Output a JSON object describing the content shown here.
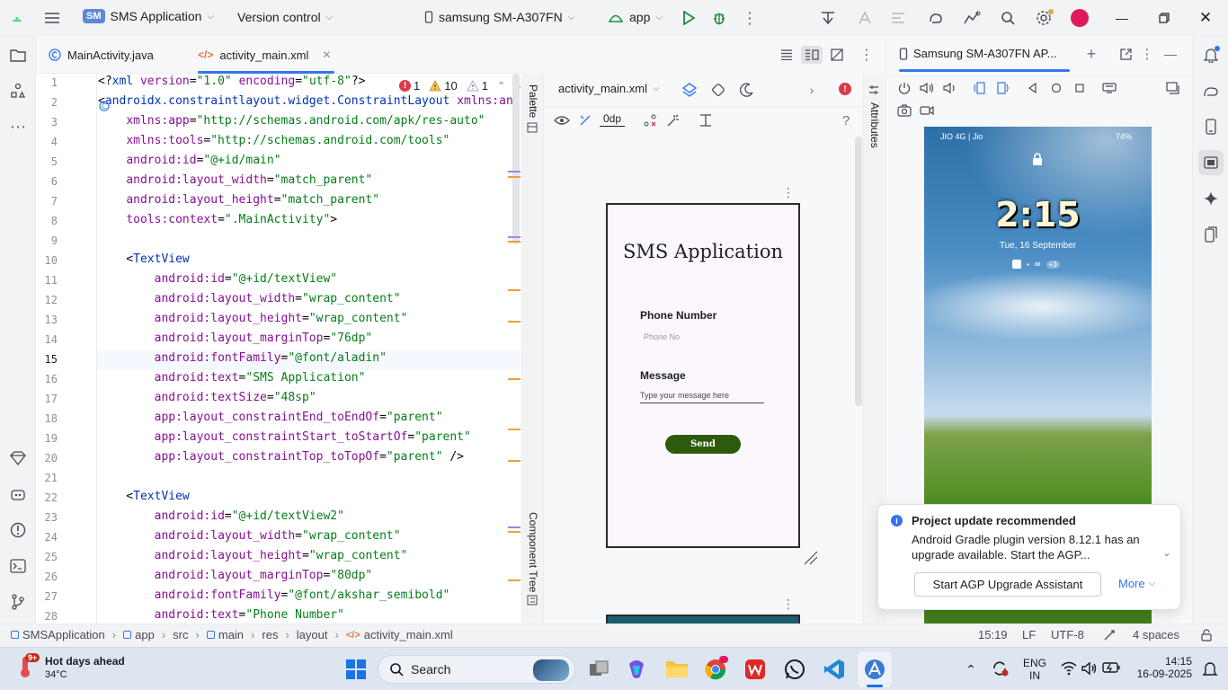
{
  "titlebar": {
    "project_badge": "SM",
    "project_name": "SMS Application",
    "version_control": "Version control",
    "device": "samsung SM-A307FN",
    "run_config": "app"
  },
  "editor_tabs": [
    {
      "label": "MainActivity.java"
    },
    {
      "label": "activity_main.xml"
    }
  ],
  "inspections": {
    "errors": "1",
    "warnings": "10",
    "weak_warnings": "1"
  },
  "code": {
    "line_numbers": [
      "1",
      "2",
      "3",
      "4",
      "5",
      "6",
      "7",
      "8",
      "9",
      "10",
      "11",
      "12",
      "13",
      "14",
      "15",
      "16",
      "17",
      "18",
      "19",
      "20",
      "21",
      "22",
      "23",
      "24",
      "25",
      "26",
      "27",
      "28"
    ],
    "lines": [
      [
        {
          "t": "t-plain",
          "v": "<?"
        },
        {
          "t": "t-tag",
          "v": "xml"
        },
        {
          "t": "t-plain",
          "v": " "
        },
        {
          "t": "t-attr",
          "v": "version"
        },
        {
          "t": "t-plain",
          "v": "="
        },
        {
          "t": "t-str",
          "v": "\"1.0\""
        },
        {
          "t": "t-plain",
          "v": " "
        },
        {
          "t": "t-attr",
          "v": "encoding"
        },
        {
          "t": "t-plain",
          "v": "="
        },
        {
          "t": "t-str",
          "v": "\"utf-8\""
        },
        {
          "t": "t-plain",
          "v": "?>"
        }
      ],
      [
        {
          "t": "t-plain",
          "v": "<"
        },
        {
          "t": "t-tag",
          "v": "androidx.constraintlayout.widget.ConstraintLayout"
        },
        {
          "t": "t-plain",
          "v": " "
        },
        {
          "t": "t-attr",
          "v": "xmlns:an"
        }
      ],
      [
        {
          "t": "t-plain",
          "v": "    "
        },
        {
          "t": "t-attr",
          "v": "xmlns:app"
        },
        {
          "t": "t-plain",
          "v": "="
        },
        {
          "t": "t-str",
          "v": "\"http://schemas.android.com/apk/res-auto\""
        }
      ],
      [
        {
          "t": "t-plain",
          "v": "    "
        },
        {
          "t": "t-attr",
          "v": "xmlns:tools"
        },
        {
          "t": "t-plain",
          "v": "="
        },
        {
          "t": "t-str",
          "v": "\"http://schemas.android.com/tools\""
        }
      ],
      [
        {
          "t": "t-plain",
          "v": "    "
        },
        {
          "t": "t-attr",
          "v": "android:id"
        },
        {
          "t": "t-plain",
          "v": "="
        },
        {
          "t": "t-str",
          "v": "\"@+id/main\""
        }
      ],
      [
        {
          "t": "t-plain",
          "v": "    "
        },
        {
          "t": "t-attr",
          "v": "android:layout_width"
        },
        {
          "t": "t-plain",
          "v": "="
        },
        {
          "t": "t-str",
          "v": "\"match_parent\""
        }
      ],
      [
        {
          "t": "t-plain",
          "v": "    "
        },
        {
          "t": "t-attr",
          "v": "android:layout_height"
        },
        {
          "t": "t-plain",
          "v": "="
        },
        {
          "t": "t-str",
          "v": "\"match_parent\""
        }
      ],
      [
        {
          "t": "t-plain",
          "v": "    "
        },
        {
          "t": "t-attr",
          "v": "tools:context"
        },
        {
          "t": "t-plain",
          "v": "="
        },
        {
          "t": "t-str",
          "v": "\".MainActivity\""
        },
        {
          "t": "t-plain",
          "v": ">"
        }
      ],
      [],
      [
        {
          "t": "t-plain",
          "v": "    <"
        },
        {
          "t": "t-tag",
          "v": "TextView"
        }
      ],
      [
        {
          "t": "t-plain",
          "v": "        "
        },
        {
          "t": "t-attr",
          "v": "android:id"
        },
        {
          "t": "t-plain",
          "v": "="
        },
        {
          "t": "t-str",
          "v": "\"@+id/textView\""
        }
      ],
      [
        {
          "t": "t-plain",
          "v": "        "
        },
        {
          "t": "t-attr",
          "v": "android:layout_width"
        },
        {
          "t": "t-plain",
          "v": "="
        },
        {
          "t": "t-str",
          "v": "\"wrap_content\""
        }
      ],
      [
        {
          "t": "t-plain",
          "v": "        "
        },
        {
          "t": "t-attr",
          "v": "android:layout_height"
        },
        {
          "t": "t-plain",
          "v": "="
        },
        {
          "t": "t-str",
          "v": "\"wrap_content\""
        }
      ],
      [
        {
          "t": "t-plain",
          "v": "        "
        },
        {
          "t": "t-attr",
          "v": "android:layout_marginTop"
        },
        {
          "t": "t-plain",
          "v": "="
        },
        {
          "t": "t-str",
          "v": "\"76dp\""
        }
      ],
      [
        {
          "t": "t-plain",
          "v": "        "
        },
        {
          "t": "t-attr",
          "v": "android:fontFamily"
        },
        {
          "t": "t-plain",
          "v": "="
        },
        {
          "t": "t-str",
          "v": "\"@font/aladin\""
        }
      ],
      [
        {
          "t": "t-plain",
          "v": "        "
        },
        {
          "t": "t-attr",
          "v": "android:text"
        },
        {
          "t": "t-plain",
          "v": "="
        },
        {
          "t": "t-str",
          "v": "\"SMS Application\""
        }
      ],
      [
        {
          "t": "t-plain",
          "v": "        "
        },
        {
          "t": "t-attr",
          "v": "android:textSize"
        },
        {
          "t": "t-plain",
          "v": "="
        },
        {
          "t": "t-str",
          "v": "\"48sp\""
        }
      ],
      [
        {
          "t": "t-plain",
          "v": "        "
        },
        {
          "t": "t-attr",
          "v": "app:layout_constraintEnd_toEndOf"
        },
        {
          "t": "t-plain",
          "v": "="
        },
        {
          "t": "t-str",
          "v": "\"parent\""
        }
      ],
      [
        {
          "t": "t-plain",
          "v": "        "
        },
        {
          "t": "t-attr",
          "v": "app:layout_constraintStart_toStartOf"
        },
        {
          "t": "t-plain",
          "v": "="
        },
        {
          "t": "t-str",
          "v": "\"parent\""
        }
      ],
      [
        {
          "t": "t-plain",
          "v": "        "
        },
        {
          "t": "t-attr",
          "v": "app:layout_constraintTop_toTopOf"
        },
        {
          "t": "t-plain",
          "v": "="
        },
        {
          "t": "t-str",
          "v": "\"parent\""
        },
        {
          "t": "t-plain",
          "v": " />"
        }
      ],
      [],
      [
        {
          "t": "t-plain",
          "v": "    <"
        },
        {
          "t": "t-tag",
          "v": "TextView"
        }
      ],
      [
        {
          "t": "t-plain",
          "v": "        "
        },
        {
          "t": "t-attr",
          "v": "android:id"
        },
        {
          "t": "t-plain",
          "v": "="
        },
        {
          "t": "t-str",
          "v": "\"@+id/textView2\""
        }
      ],
      [
        {
          "t": "t-plain",
          "v": "        "
        },
        {
          "t": "t-attr",
          "v": "android:layout_width"
        },
        {
          "t": "t-plain",
          "v": "="
        },
        {
          "t": "t-str",
          "v": "\"wrap_content\""
        }
      ],
      [
        {
          "t": "t-plain",
          "v": "        "
        },
        {
          "t": "t-attr",
          "v": "android:layout_height"
        },
        {
          "t": "t-plain",
          "v": "="
        },
        {
          "t": "t-str",
          "v": "\"wrap_content\""
        }
      ],
      [
        {
          "t": "t-plain",
          "v": "        "
        },
        {
          "t": "t-attr",
          "v": "android:layout_marginTop"
        },
        {
          "t": "t-plain",
          "v": "="
        },
        {
          "t": "t-str",
          "v": "\"80dp\""
        }
      ],
      [
        {
          "t": "t-plain",
          "v": "        "
        },
        {
          "t": "t-attr",
          "v": "android:fontFamily"
        },
        {
          "t": "t-plain",
          "v": "="
        },
        {
          "t": "t-str",
          "v": "\"@font/akshar_semibold\""
        }
      ],
      [
        {
          "t": "t-plain",
          "v": "        "
        },
        {
          "t": "t-attr",
          "v": "android:text"
        },
        {
          "t": "t-plain",
          "v": "="
        },
        {
          "t": "t-str",
          "v": "\"Phone Number\""
        }
      ]
    ]
  },
  "design": {
    "file_selector": "activity_main.xml",
    "margin_value": "0dp",
    "palette_label": "Palette",
    "component_tree_label": "Component Tree",
    "attributes_label": "Attributes",
    "preview": {
      "title": "SMS Application",
      "phone_label": "Phone Number",
      "phone_hint": "Phone No",
      "message_label": "Message",
      "message_hint": "Type your message here",
      "send_button": "Send",
      "button_color": "#2d5a0c"
    }
  },
  "device_panel": {
    "tab_title": "Samsung SM-A307FN AP...",
    "status_left": "JIO 4G | Jio",
    "battery": "74%",
    "clock": "2:15",
    "date": "Tue, 16 September",
    "notif_count": "+3"
  },
  "notification": {
    "title": "Project update recommended",
    "body": "Android Gradle plugin version 8.12.1 has an upgrade available. Start the AGP...",
    "action_button": "Start AGP Upgrade Assistant",
    "more_link": "More"
  },
  "statusbar": {
    "breadcrumbs": [
      "SMSApplication",
      "app",
      "src",
      "main",
      "res",
      "layout",
      "activity_main.xml"
    ],
    "position": "15:19",
    "line_sep": "LF",
    "encoding": "UTF-8",
    "indent": "4 spaces"
  },
  "taskbar": {
    "weather_title": "Hot days ahead",
    "weather_temp": "34°C",
    "weather_badge": "9+",
    "search": "Search",
    "lang": "ENG",
    "region": "IN",
    "time": "14:15",
    "date": "16-09-2025"
  },
  "colors": {
    "accent": "#3574f0",
    "error": "#db3b4b",
    "warning": "#e8a33d",
    "run_green": "#208a3c"
  }
}
